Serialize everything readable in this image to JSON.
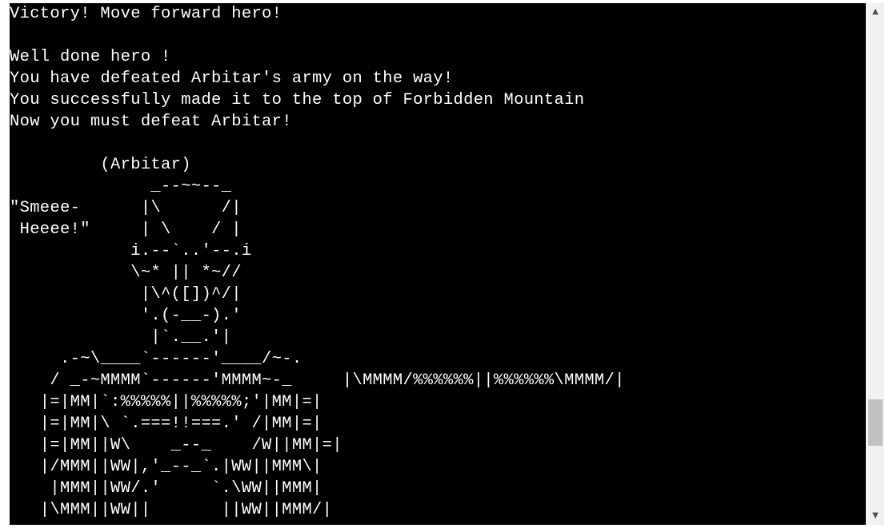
{
  "terminal": {
    "lines": [
      "Victory! Move forward hero!",
      "",
      "Well done hero !",
      "You have defeated Arbitar's army on the way!",
      "You successfully made it to the top of Forbidden Mountain",
      "Now you must defeat Arbitar!",
      "",
      "         (Arbitar)",
      "              _--~~--_",
      "\"Smeee-      |\\      /|",
      " Heeee!\"     | \\    / |",
      "            i.--`..'--.i",
      "            \\~* || *~//",
      "             |\\^([])^/|",
      "             '.(-__-).'",
      "              |`.__.'|",
      "     .-~\\____`------'____/~-.",
      "    / _-~MMMM`------'MMMM~-_     |\\MMMM/%%%%%%||%%%%%%\\MMMM/|",
      "   |=|MM|`:%%%%%||%%%%%;'|MM|=|",
      "   |=|MM|\\ `.===!!===.' /|MM|=|",
      "   |=|MM||W\\    _--_    /W||MM|=|",
      "   |/MMM||WW|,'_--_`.|WW||MMM\\|",
      "    |MMM||WW/.'     `.\\WW||MMM|",
      "   |\\MMM||WW||       ||WW||MMM/|"
    ]
  },
  "scrollbar": {
    "up_arrow": "▲",
    "down_arrow": "▼",
    "position_fraction": 0.86
  }
}
